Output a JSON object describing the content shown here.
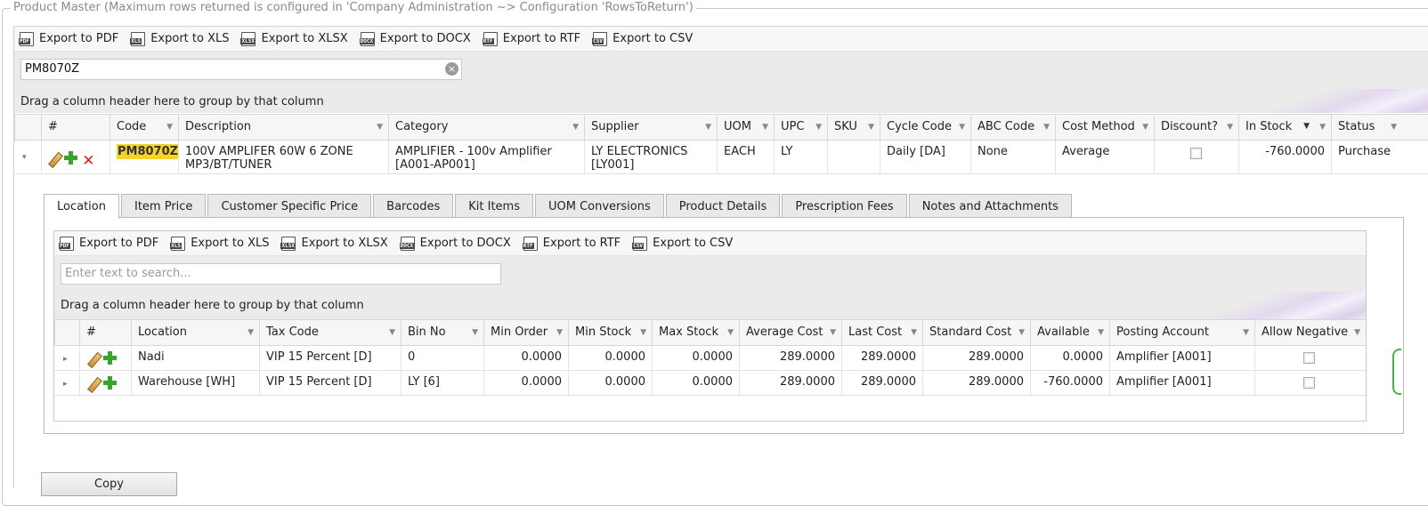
{
  "legend": "Product Master (Maximum rows returned is configured in 'Company Administration ~> Configuration 'RowsToReturn')",
  "export_buttons": [
    {
      "badge": "PDF",
      "label": "Export to PDF"
    },
    {
      "badge": "XLS",
      "label": "Export to XLS"
    },
    {
      "badge": "XLSX",
      "label": "Export to XLSX"
    },
    {
      "badge": "DOCX",
      "label": "Export to DOCX"
    },
    {
      "badge": "RTF",
      "label": "Export to RTF"
    },
    {
      "badge": "CSV",
      "label": "Export to CSV"
    }
  ],
  "search": {
    "value": "PM8070Z",
    "clear_glyph": "×"
  },
  "group_panel_text": "Drag a column header here to group by that column",
  "columns": [
    "#",
    "Code",
    "Description",
    "Category",
    "Supplier",
    "UOM",
    "UPC",
    "SKU",
    "Cycle Code",
    "ABC Code",
    "Cost Method",
    "Discount?",
    "In Stock",
    "Status"
  ],
  "sort_indicator": "▼",
  "filter_glyph": "▼",
  "product_row": {
    "code": "PM8070Z",
    "description": "100V AMPLIFER 60W 6 ZONE MP3/BT/TUNER",
    "category": "AMPLIFIER - 100v Amplifier [A001-AP001]",
    "supplier": "LY ELECTRONICS [LY001]",
    "uom": "EACH",
    "upc": "LY",
    "sku": "",
    "cycle_code": "Daily [DA]",
    "abc_code": "None",
    "cost_method": "Average",
    "discount": false,
    "in_stock": "-760.0000",
    "status": "Purchase"
  },
  "tabs": [
    "Location",
    "Item Price",
    "Customer Specific Price",
    "Barcodes",
    "Kit Items",
    "UOM Conversions",
    "Product Details",
    "Prescription Fees",
    "Notes and Attachments"
  ],
  "active_tab": "Location",
  "location_grid": {
    "search_placeholder": "Enter text to search...",
    "group_panel_text": "Drag a column header here to group by that column",
    "columns": [
      "#",
      "Location",
      "Tax Code",
      "Bin No",
      "Min Order",
      "Min Stock",
      "Max Stock",
      "Average Cost",
      "Last Cost",
      "Standard Cost",
      "Available",
      "Posting Account",
      "Allow Negative"
    ],
    "rows": [
      {
        "location": "Nadi",
        "tax_code": "VIP 15 Percent [D]",
        "bin_no": "0",
        "min_order": "0.0000",
        "min_stock": "0.0000",
        "max_stock": "0.0000",
        "average_cost": "289.0000",
        "last_cost": "289.0000",
        "standard_cost": "289.0000",
        "available": "0.0000",
        "posting_account": "Amplifier [A001]",
        "allow_negative": false
      },
      {
        "location": "Warehouse [WH]",
        "tax_code": "VIP 15 Percent [D]",
        "bin_no": "LY [6]",
        "min_order": "0.0000",
        "min_stock": "0.0000",
        "max_stock": "0.0000",
        "average_cost": "289.0000",
        "last_cost": "289.0000",
        "standard_cost": "289.0000",
        "available": "-760.0000",
        "posting_account": "Amplifier [A001]",
        "allow_negative": false
      }
    ]
  },
  "copy_button": "Copy",
  "icons": {
    "expand_collapsed": "▸",
    "expand_open": "▾",
    "delete": "✕"
  },
  "colors": {
    "highlight": "#f6d329",
    "add_green": "#38a42d",
    "delete_red": "#e02020"
  }
}
